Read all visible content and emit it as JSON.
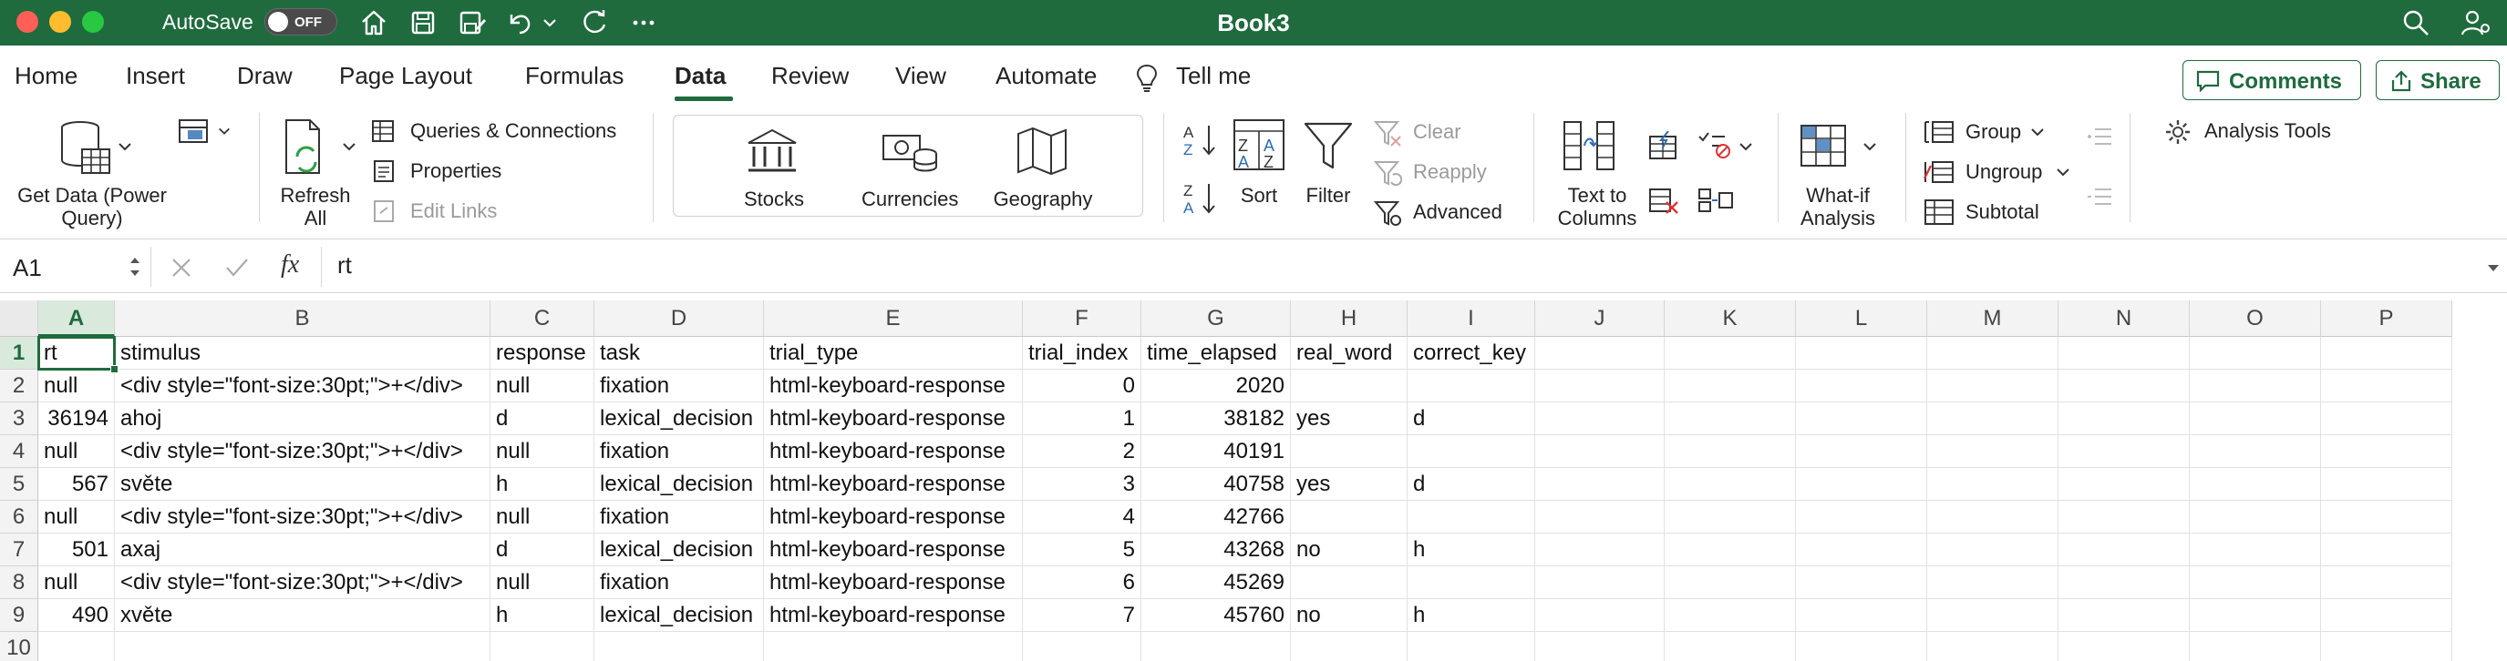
{
  "window": {
    "title": "Book3",
    "autosave_label": "AutoSave",
    "autosave_state": "OFF"
  },
  "tabs": [
    {
      "label": "Home"
    },
    {
      "label": "Insert"
    },
    {
      "label": "Draw"
    },
    {
      "label": "Page Layout"
    },
    {
      "label": "Formulas"
    },
    {
      "label": "Data",
      "active": true
    },
    {
      "label": "Review"
    },
    {
      "label": "View"
    },
    {
      "label": "Automate"
    },
    {
      "label": "Tell me"
    }
  ],
  "header_buttons": {
    "comments": "Comments",
    "share": "Share"
  },
  "ribbon": {
    "get_data": "Get Data (Power Query)",
    "refresh_all": "Refresh All",
    "queries_connections": "Queries & Connections",
    "properties": "Properties",
    "edit_links": "Edit Links",
    "stocks": "Stocks",
    "currencies": "Currencies",
    "geography": "Geography",
    "sort": "Sort",
    "filter": "Filter",
    "clear": "Clear",
    "reapply": "Reapply",
    "advanced": "Advanced",
    "text_to_columns": "Text to Columns",
    "what_if": "What-if Analysis",
    "group": "Group",
    "ungroup": "Ungroup",
    "subtotal": "Subtotal",
    "analysis_tools": "Analysis Tools"
  },
  "formula_bar": {
    "name_box": "A1",
    "fx": "fx",
    "formula": "rt"
  },
  "sheet": {
    "selected_cell": "A1",
    "columns": [
      "A",
      "B",
      "C",
      "D",
      "E",
      "F",
      "G",
      "H",
      "I",
      "J",
      "K",
      "L",
      "M",
      "N",
      "O",
      "P"
    ],
    "row_numbers": [
      "1",
      "2",
      "3",
      "4",
      "5",
      "6",
      "7",
      "8",
      "9",
      "10"
    ],
    "rows": [
      [
        "rt",
        "stimulus",
        "response",
        "task",
        "trial_type",
        "trial_index",
        "time_elapsed",
        "real_word",
        "correct_key"
      ],
      [
        "null",
        "<div style=\"font-size:30pt;\">+</div>",
        "null",
        "fixation",
        "html-keyboard-response",
        "0",
        "2020",
        "",
        ""
      ],
      [
        "36194",
        "ahoj",
        "d",
        "lexical_decision",
        "html-keyboard-response",
        "1",
        "38182",
        "yes",
        "d"
      ],
      [
        "null",
        "<div style=\"font-size:30pt;\">+</div>",
        "null",
        "fixation",
        "html-keyboard-response",
        "2",
        "40191",
        "",
        ""
      ],
      [
        "567",
        "světe",
        "h",
        "lexical_decision",
        "html-keyboard-response",
        "3",
        "40758",
        "yes",
        "d"
      ],
      [
        "null",
        "<div style=\"font-size:30pt;\">+</div>",
        "null",
        "fixation",
        "html-keyboard-response",
        "4",
        "42766",
        "",
        ""
      ],
      [
        "501",
        "axaj",
        "d",
        "lexical_decision",
        "html-keyboard-response",
        "5",
        "43268",
        "no",
        "h"
      ],
      [
        "null",
        "<div style=\"font-size:30pt;\">+</div>",
        "null",
        "fixation",
        "html-keyboard-response",
        "6",
        "45269",
        "",
        ""
      ],
      [
        "490",
        "xvěte",
        "h",
        "lexical_decision",
        "html-keyboard-response",
        "7",
        "45760",
        "no",
        "h"
      ],
      [
        "",
        "",
        "",
        "",
        "",
        "",
        "",
        "",
        ""
      ]
    ]
  }
}
